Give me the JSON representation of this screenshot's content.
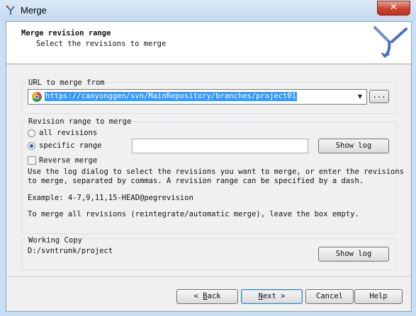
{
  "window": {
    "title": "Merge",
    "close_glyph": "✕"
  },
  "header": {
    "title": "Merge revision range",
    "subtitle": "Select the revisions to merge"
  },
  "url_group": {
    "label": "URL to merge from",
    "value": "https://caoyonggen/svn/MainRepository/branches/project01",
    "browse_label": "..."
  },
  "revision_group": {
    "label": "Revision range to merge",
    "option_all": "all revisions",
    "option_specific": "specific range",
    "selected": "specific range",
    "range_value": "",
    "show_log_label": "Show log",
    "reverse_label": "Reverse merge",
    "reverse_checked": false,
    "help_line1": "Use the log dialog to select the revisions you want to merge, or enter the revisions",
    "help_line2": "to merge, separated by commas. A revision range can be specified by a dash.",
    "example": "Example: 4-7,9,11,15-HEAD@pegrevision",
    "reintegrate_hint": "To merge all revisions (reintegrate/automatic merge), leave the box empty."
  },
  "working_copy": {
    "label": "Working Copy",
    "path": "D:/svntrunk/project",
    "show_log_label": "Show log"
  },
  "buttons": {
    "back_arrow": "<",
    "back_mnemonic": "B",
    "back_rest": "ack",
    "next_mnemonic": "N",
    "next_rest": "ext",
    "next_arrow": ">",
    "cancel_label": "Cancel",
    "help_label": "Help"
  },
  "colors": {
    "selection": "#3399ff",
    "radio_dot": "#2b63b6",
    "titlebar": "#c5daf0",
    "close_button": "#c9452f"
  },
  "icons": [
    "merge-app-icon",
    "close-icon",
    "tortoisesvn-logo",
    "chrome-icon",
    "chevron-down-icon"
  ]
}
